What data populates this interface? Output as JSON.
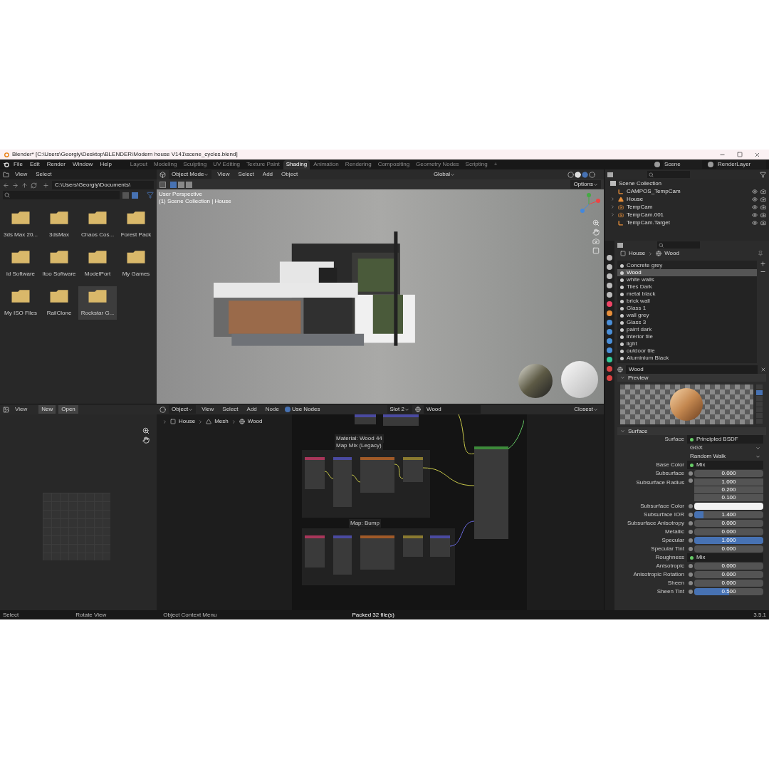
{
  "window": {
    "title": "Blender* [C:\\Users\\Georgiy\\Desktop\\BLENDER\\Modern house V141\\scene_cycles.blend]"
  },
  "menu": [
    "File",
    "Edit",
    "Render",
    "Window",
    "Help"
  ],
  "workspaces": [
    {
      "label": "Layout",
      "selected": false
    },
    {
      "label": "Modeling",
      "selected": false
    },
    {
      "label": "Sculpting",
      "selected": false
    },
    {
      "label": "UV Editing",
      "selected": false
    },
    {
      "label": "Texture Paint",
      "selected": false
    },
    {
      "label": "Shading",
      "selected": true
    },
    {
      "label": "Animation",
      "selected": false
    },
    {
      "label": "Rendering",
      "selected": false
    },
    {
      "label": "Compositing",
      "selected": false
    },
    {
      "label": "Geometry Nodes",
      "selected": false
    },
    {
      "label": "Scripting",
      "selected": false
    },
    {
      "label": "+",
      "selected": false
    }
  ],
  "scene": {
    "name": "Scene",
    "view_layer": "RenderLayer"
  },
  "file_browser": {
    "menus": [
      "View",
      "Select"
    ],
    "path": "C:\\Users\\Georgiy\\Documents\\",
    "folders": [
      {
        "label": "3ds Max 20...",
        "selected": false
      },
      {
        "label": "3dsMax",
        "selected": false
      },
      {
        "label": "Chaos Cos...",
        "selected": false
      },
      {
        "label": "Forest Pack",
        "selected": false
      },
      {
        "label": "id Software",
        "selected": false
      },
      {
        "label": "Itoo Software",
        "selected": false
      },
      {
        "label": "ModelPort",
        "selected": false
      },
      {
        "label": "My Games",
        "selected": false
      },
      {
        "label": "My ISO Files",
        "selected": false
      },
      {
        "label": "RailClone",
        "selected": false
      },
      {
        "label": "Rockstar G...",
        "selected": true
      }
    ]
  },
  "viewport": {
    "mode": "Object Mode",
    "menus": [
      "View",
      "Select",
      "Add",
      "Object"
    ],
    "orientation": "Global",
    "options": "Options",
    "overlay": [
      "User Perspective",
      "(1) Scene Collection | House"
    ]
  },
  "outliner": {
    "root": "Scene Collection",
    "items": [
      {
        "label": "CAMPOS_TempCam",
        "kind": "empty"
      },
      {
        "label": "House",
        "kind": "mesh"
      },
      {
        "label": "TempCam",
        "kind": "camera"
      },
      {
        "label": "TempCam.001",
        "kind": "camera"
      },
      {
        "label": "TempCam.Target",
        "kind": "empty"
      }
    ]
  },
  "properties": {
    "breadcrumb": [
      "House",
      "Wood"
    ],
    "slots": [
      {
        "label": "Concrete grey",
        "selected": false
      },
      {
        "label": "Wood",
        "selected": true
      },
      {
        "label": "white walls",
        "selected": false
      },
      {
        "label": "Tiles Dark",
        "selected": false
      },
      {
        "label": "metal black",
        "selected": false
      },
      {
        "label": "brick wall",
        "selected": false
      },
      {
        "label": "Glass 1",
        "selected": false
      },
      {
        "label": "wall grey",
        "selected": false
      },
      {
        "label": "Glass 3",
        "selected": false
      },
      {
        "label": "paint dark",
        "selected": false
      },
      {
        "label": "interior tile",
        "selected": false
      },
      {
        "label": "light",
        "selected": false
      },
      {
        "label": "outdoor tile",
        "selected": false
      },
      {
        "label": "Aluminium Black",
        "selected": false
      }
    ],
    "material": "Wood",
    "preview_title": "Preview",
    "surface_title": "Surface",
    "fields": [
      {
        "kind": "link",
        "label": "Surface",
        "value": "Principled BSDF"
      },
      {
        "kind": "dropdown",
        "value": "GGX"
      },
      {
        "kind": "dropdown",
        "value": "Random Walk"
      },
      {
        "kind": "link",
        "label": "Base Color",
        "value": "Mix"
      },
      {
        "kind": "number",
        "label": "Subsurface",
        "value": "0.000",
        "level": 0
      },
      {
        "kind": "vector",
        "label": "Subsurface Radius",
        "values": [
          "1.000",
          "0.200",
          "0.100"
        ]
      },
      {
        "kind": "color",
        "label": "Subsurface Color",
        "color": "#f2f2f2"
      },
      {
        "kind": "number",
        "label": "Subsurface IOR",
        "value": "1.400",
        "level": 0.13
      },
      {
        "kind": "number",
        "label": "Subsurface Anisotropy",
        "value": "0.000",
        "level": 0
      },
      {
        "kind": "number",
        "label": "Metallic",
        "value": "0.000",
        "level": 0
      },
      {
        "kind": "number",
        "label": "Specular",
        "value": "1.000",
        "level": 1
      },
      {
        "kind": "number",
        "label": "Specular Tint",
        "value": "0.000",
        "level": 0
      },
      {
        "kind": "link",
        "label": "Roughness",
        "value": "Mix"
      },
      {
        "kind": "number",
        "label": "Anisotropic",
        "value": "0.000",
        "level": 0
      },
      {
        "kind": "number",
        "label": "Anisotropic Rotation",
        "value": "0.000",
        "level": 0
      },
      {
        "kind": "number",
        "label": "Sheen",
        "value": "0.000",
        "level": 0
      },
      {
        "kind": "number",
        "label": "Sheen Tint",
        "value": "0.500",
        "level": 0.5
      }
    ]
  },
  "image_editor": {
    "menus": [
      "View"
    ],
    "new": "New",
    "open": "Open"
  },
  "node_editor": {
    "editor": "Object",
    "menus": [
      "View",
      "Select",
      "Add",
      "Node"
    ],
    "use_nodes": {
      "label": "Use Nodes",
      "checked": true
    },
    "slot": "Slot 2",
    "material": "Wood",
    "interpolation": "Closest",
    "breadcrumb": [
      "House",
      "Mesh",
      "Wood"
    ],
    "frames": [
      "Material: Wood 44",
      "Map Mix (Legacy)",
      "Map: Bump"
    ]
  },
  "status_bar": {
    "left": [
      "Select",
      "Rotate View",
      "Object Context Menu"
    ],
    "message": "Packed 32 file(s)",
    "version": "3.5.1"
  }
}
